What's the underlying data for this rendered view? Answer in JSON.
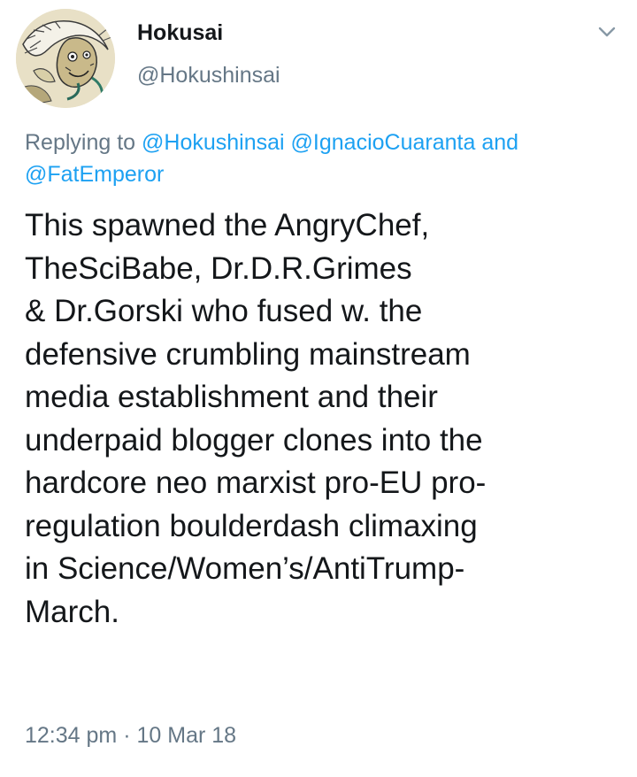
{
  "author": {
    "display_name": "Hokusai",
    "handle": "@Hokushinsai"
  },
  "replying": {
    "prefix": "Replying to",
    "mentions": [
      "@Hokushinsai",
      "@IgnacioCuaranta",
      "@FatEmperor"
    ],
    "conjunction": "and"
  },
  "tweet": {
    "lines": [
      "This spawned the AngryChef,",
      "TheSciBabe, Dr.D.R.Grimes",
      "& Dr.Gorski who fused w. the",
      "defensive crumbling mainstream",
      "media establishment and their",
      "underpaid blogger clones into the",
      "hardcore neo marxist pro-EU pro-",
      "regulation boulderdash climaxing",
      "in Science/Women’s/AntiTrump-",
      "March."
    ]
  },
  "meta": {
    "time": "12:34 pm",
    "separator": "·",
    "date": "10 Mar 18"
  },
  "colors": {
    "link": "#1da1f2",
    "secondary_text": "#657786",
    "primary_text": "#14171a"
  },
  "icons": {
    "menu": "chevron-down-icon",
    "avatar": "avatar"
  }
}
